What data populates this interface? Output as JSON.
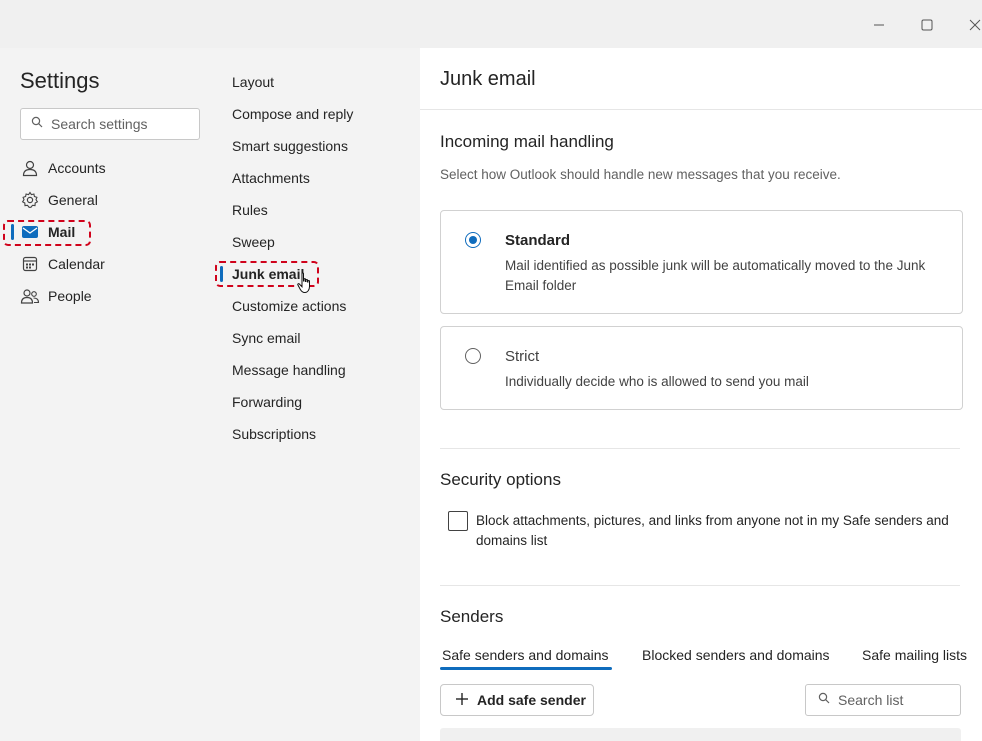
{
  "window": {
    "minimize_icon": "minimize-icon",
    "maximize_icon": "maximize-icon",
    "close_icon": "close-icon"
  },
  "sidebar": {
    "title": "Settings",
    "search_placeholder": "Search settings",
    "items": [
      {
        "label": "Accounts",
        "icon": "person-icon"
      },
      {
        "label": "General",
        "icon": "gear-icon"
      },
      {
        "label": "Mail",
        "icon": "mail-icon",
        "active": true
      },
      {
        "label": "Calendar",
        "icon": "calendar-icon"
      },
      {
        "label": "People",
        "icon": "people-icon"
      }
    ]
  },
  "subnav": {
    "items": [
      {
        "label": "Layout"
      },
      {
        "label": "Compose and reply"
      },
      {
        "label": "Smart suggestions"
      },
      {
        "label": "Attachments"
      },
      {
        "label": "Rules"
      },
      {
        "label": "Sweep"
      },
      {
        "label": "Junk email",
        "active": true
      },
      {
        "label": "Customize actions"
      },
      {
        "label": "Sync email"
      },
      {
        "label": "Message handling"
      },
      {
        "label": "Forwarding"
      },
      {
        "label": "Subscriptions"
      }
    ]
  },
  "main": {
    "title": "Junk email",
    "incoming": {
      "heading": "Incoming mail handling",
      "description": "Select how Outlook should handle new messages that you receive.",
      "options": [
        {
          "title": "Standard",
          "description": "Mail identified as possible junk will be automatically moved to the Junk Email folder",
          "selected": true
        },
        {
          "title": "Strict",
          "description": "Individually decide who is allowed to send you mail",
          "selected": false
        }
      ]
    },
    "security": {
      "heading": "Security options",
      "checkbox_label": "Block attachments, pictures, and links from anyone not in my Safe senders and domains list",
      "checked": false
    },
    "senders": {
      "heading": "Senders",
      "tabs": [
        "Safe senders and domains",
        "Blocked senders and domains",
        "Safe mailing lists"
      ],
      "active_tab": 0,
      "add_button": "Add safe sender",
      "search_placeholder": "Search list"
    }
  },
  "colors": {
    "accent": "#0f6cbd",
    "highlight": "#d0021b"
  }
}
